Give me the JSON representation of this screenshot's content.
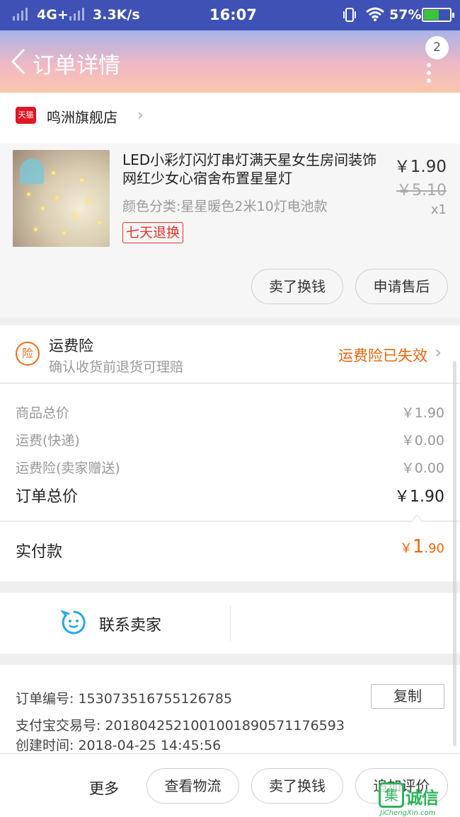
{
  "status_bar": {
    "network": "4G+",
    "speed": "3.3K/s",
    "time": "16:07",
    "battery": "57%",
    "battery_level": 0.57
  },
  "header": {
    "title": "订单详情",
    "message_count": "2"
  },
  "shop": {
    "badge": "天猫",
    "name": "鸣洲旗舰店"
  },
  "product": {
    "title": "LED小彩灯闪灯串灯满天星女生房间装饰网红少女心宿舍布置星星灯",
    "spec": "颜色分类:星星暖色2米10灯电池款",
    "tag": "七天退换",
    "price": "￥1.90",
    "original_price": "￥5.10",
    "quantity": "x1",
    "buttons": {
      "sell": "卖了换钱",
      "after_sale": "申请售后"
    }
  },
  "insurance": {
    "icon_label": "险",
    "title": "运费险",
    "subtitle": "确认收货前退货可理赔",
    "status": "运费险已失效"
  },
  "costs": {
    "rows": [
      {
        "label": "商品总价",
        "value": "￥1.90"
      },
      {
        "label": "运费(快递)",
        "value": "￥0.00"
      },
      {
        "label": "运费险(卖家赠送)",
        "value": "￥0.00"
      }
    ],
    "total_label": "订单总价",
    "total_value": "￥1.90"
  },
  "paid": {
    "label": "实付款",
    "currency": "￥",
    "integer": "1",
    "decimal": ".90"
  },
  "contact": {
    "label": "联系卖家"
  },
  "order_info": {
    "order_no_label": "订单编号:",
    "order_no": "153073516755126785",
    "copy": "复制",
    "alipay_label": "支付宝交易号:",
    "alipay_no": "2018042521001001890571176593",
    "created_label": "创建时间:",
    "created": "2018-04-25 14:45:56"
  },
  "bottom_bar": {
    "more": "更多",
    "logistics": "查看物流",
    "sell": "卖了换钱",
    "review": "追加评价"
  },
  "watermark": {
    "logo": "集",
    "text": "诚信",
    "url": "JiChengXin.com"
  },
  "colors": {
    "status_bar": "#3f51b5",
    "accent_orange": "#e8660d",
    "tmall_red": "#e01622",
    "tag_red": "#e2342b"
  }
}
